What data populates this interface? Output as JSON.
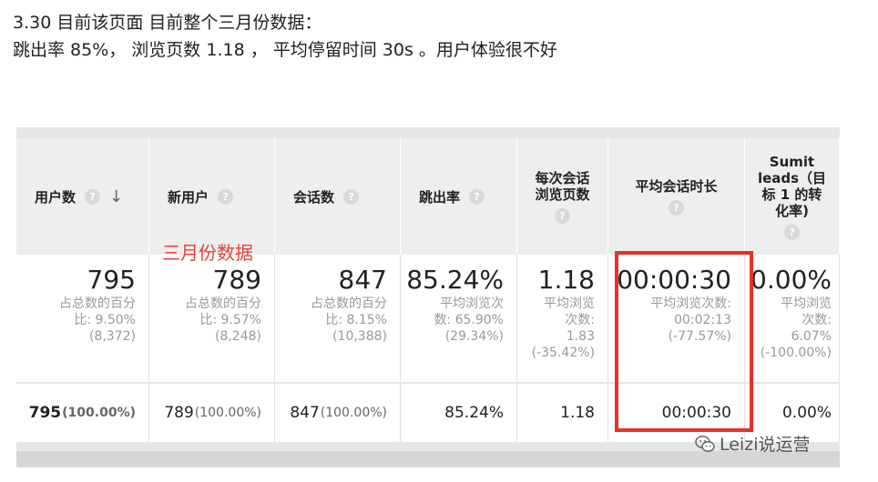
{
  "intro": {
    "line1": "3.30 目前该页面 目前整个三月份数据：",
    "line2": "跳出率 85%， 浏览页数 1.18 ， 平均停留时间  30s 。用户体验很不好"
  },
  "help_glyph": "?",
  "sort_glyph": "↓",
  "table": {
    "columns": [
      {
        "label": "用户数",
        "main": "795",
        "sub": [
          "占总数的百分",
          "比: 9.50%",
          "(8,372)"
        ],
        "total_value": "795",
        "total_pct": "(100.00%)"
      },
      {
        "label": "新用户",
        "main": "789",
        "sub": [
          "占总数的百分",
          "比: 9.57%",
          "(8,248)"
        ],
        "total_value": "789",
        "total_pct": "(100.00%)"
      },
      {
        "label": "会话数",
        "main": "847",
        "sub": [
          "占总数的百分",
          "比: 8.15%",
          "(10,388)"
        ],
        "total_value": "847",
        "total_pct": "(100.00%)"
      },
      {
        "label": "跳出率",
        "main": "85.24%",
        "sub": [
          "平均浏览次",
          "数: 65.90%",
          "(29.34%)"
        ],
        "total_value": "85.24%"
      },
      {
        "label_lines": [
          "每次会话",
          "浏览页数"
        ],
        "main": "1.18",
        "sub": [
          "平均浏览",
          "次数:",
          "1.83",
          "(-35.42%)"
        ],
        "total_value": "1.18"
      },
      {
        "label": "平均会话时长",
        "main": "00:00:30",
        "sub": [
          "平均浏览次数:",
          "00:02:13",
          "(-77.57%)"
        ],
        "total_value": "00:00:30"
      },
      {
        "label_lines": [
          "Sumit",
          "leads（目",
          "标 1 的转",
          "化率)"
        ],
        "main": "0.00%",
        "sub": [
          "平均浏览",
          "次数:",
          "6.07%",
          "(-100.00%)"
        ],
        "total_value": "0.00%"
      }
    ]
  },
  "annotation": "三月份数据",
  "watermark": "Leizi说运营",
  "colors": {
    "annotation_red": "#e5433a",
    "box_red": "#e5322b",
    "header_bg": "#eeeeee"
  }
}
